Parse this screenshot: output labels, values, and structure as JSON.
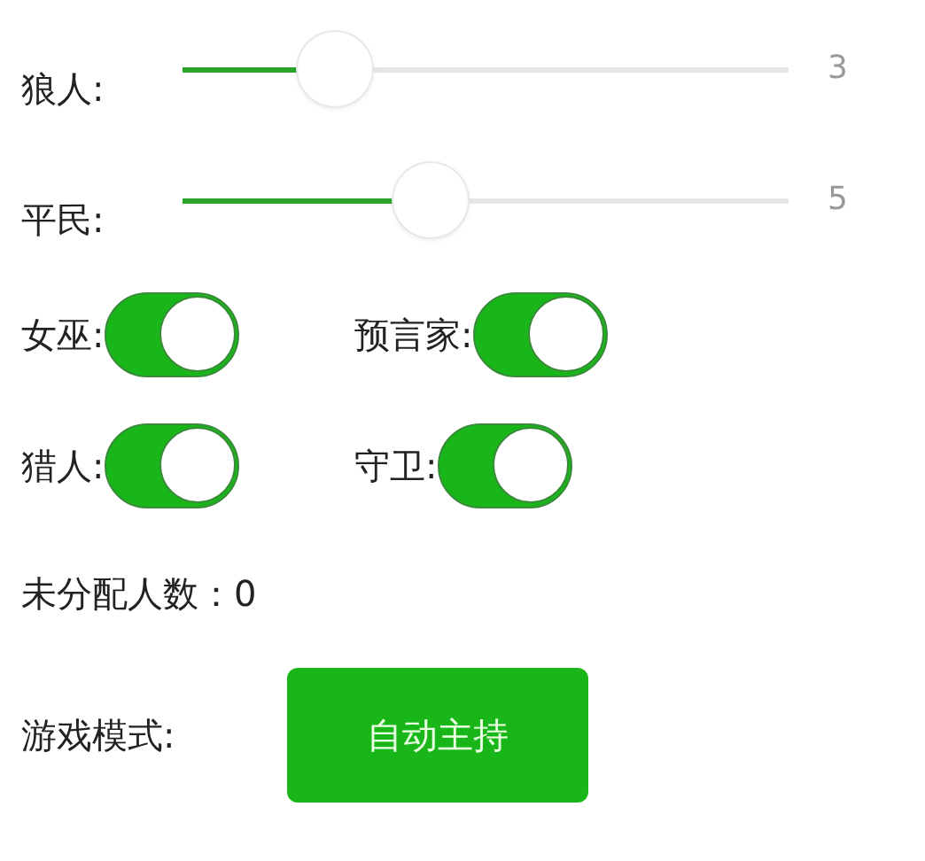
{
  "sliders": [
    {
      "label": "狼人:",
      "level": 0.25,
      "reading": "3"
    },
    {
      "label": "平民:",
      "level": 0.41,
      "reading": "5"
    }
  ],
  "switch_rows": [
    [
      {
        "label": "女巫:",
        "on": true
      },
      {
        "label": "预言家:",
        "on": true
      }
    ],
    [
      {
        "label": "猎人:",
        "on": true
      },
      {
        "label": "守卫:",
        "on": true
      }
    ]
  ],
  "unassigned": "未分配人数：0",
  "game_mode": {
    "label": "游戏模式:",
    "button": "自动主持"
  }
}
